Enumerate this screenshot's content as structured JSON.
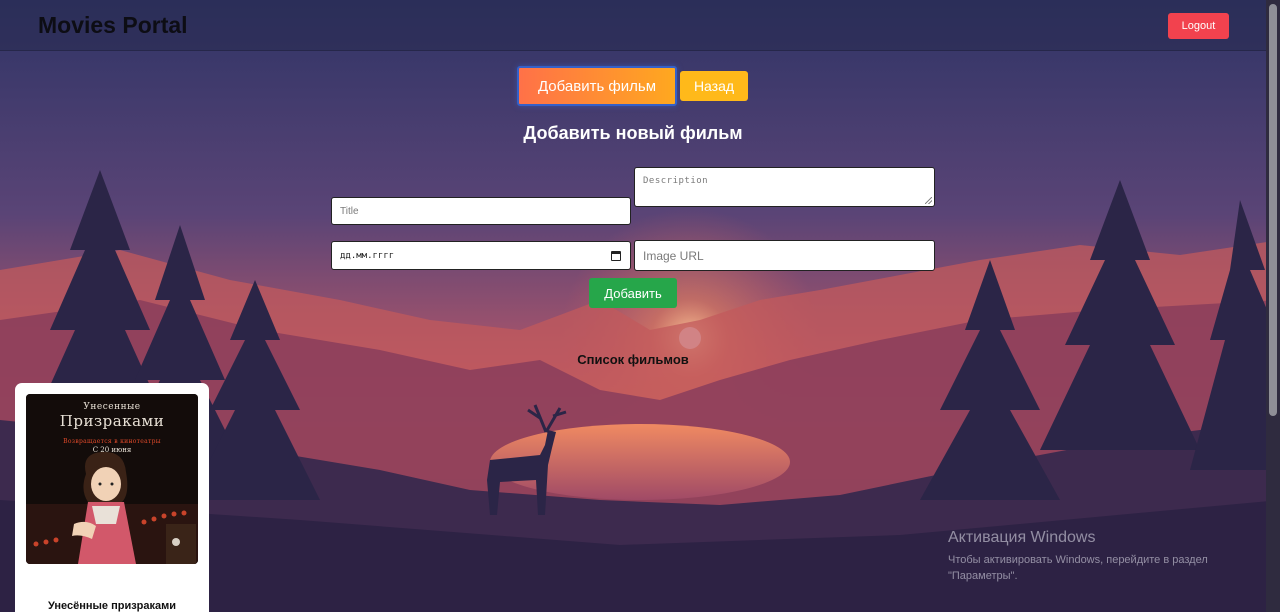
{
  "header": {
    "brand": "Movies Portal",
    "logout_label": "Logout"
  },
  "controls": {
    "add_movie_label": "Добавить фильм",
    "back_label": "Назад"
  },
  "form": {
    "title": "Добавить новый фильм",
    "title_placeholder": "Title",
    "description_placeholder": "Description",
    "date_placeholder": "дд.мм.гггг",
    "image_url_placeholder": "Image URL",
    "submit_label": "Добавить"
  },
  "movies": {
    "heading": "Список фильмов",
    "items": [
      {
        "name": "Унесённые призраками",
        "poster_title_top": "Унесенные",
        "poster_title_bottom": "Призраками",
        "poster_subtitle": "Возвращается в кинотеатры",
        "poster_date": "С 20 июня"
      }
    ]
  },
  "watermark": {
    "title": "Активация Windows",
    "line1": "Чтобы активировать Windows, перейдите в раздел",
    "line2": "\"Параметры\"."
  },
  "colors": {
    "logout": "#f2424e",
    "back": "#ffb91a",
    "submit": "#26a64a",
    "accent_gradient_start": "#ff7148",
    "accent_gradient_end": "#ffa81f"
  }
}
